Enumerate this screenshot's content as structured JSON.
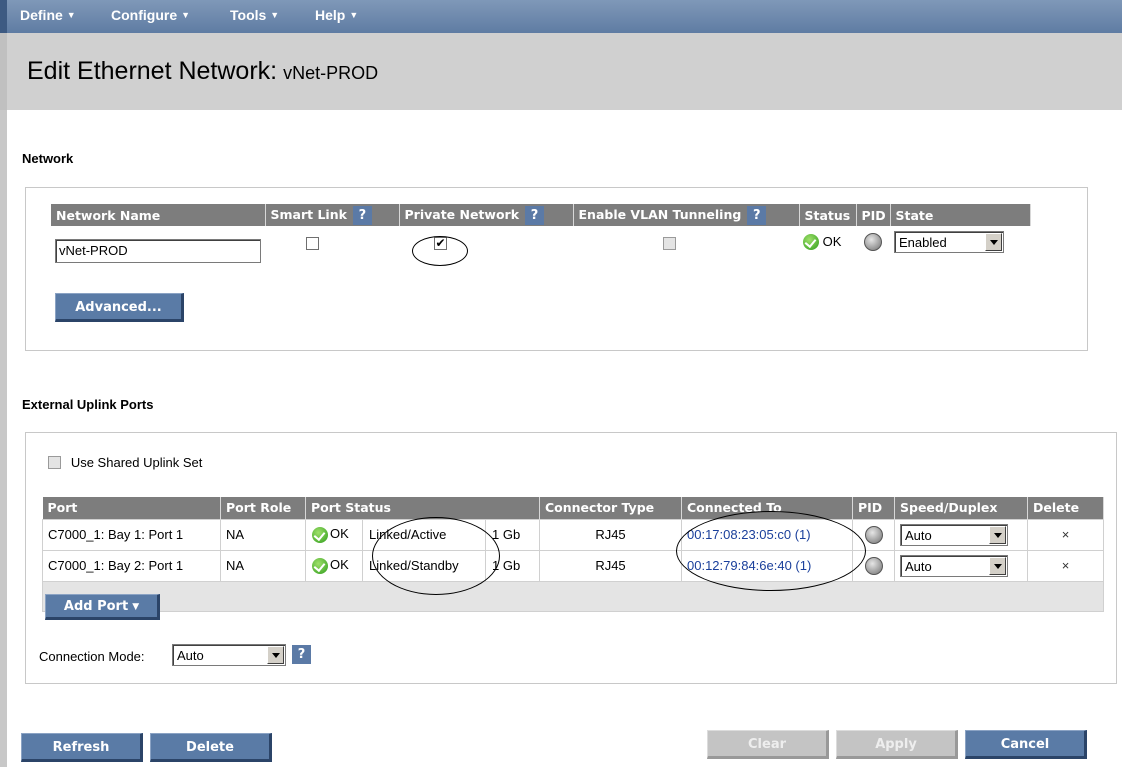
{
  "menu": [
    "Define",
    "Configure",
    "Tools",
    "Help"
  ],
  "title": {
    "main": "Edit Ethernet Network:",
    "network": "vNet-PROD"
  },
  "network_section": {
    "heading": "Network",
    "headers": {
      "name": "Network Name",
      "smart_link": "Smart Link",
      "private_network": "Private Network",
      "vlan_tunneling": "Enable VLAN Tunneling",
      "status": "Status",
      "pid": "PID",
      "state": "State"
    },
    "help_mark": "?",
    "row": {
      "name_value": "vNet-PROD",
      "smart_link_checked": false,
      "private_network_checked": true,
      "vlan_tunneling_checked": false,
      "status": "OK",
      "state": "Enabled"
    },
    "advanced_label": "Advanced..."
  },
  "uplink_section": {
    "heading": "External Uplink Ports",
    "use_shared_label": "Use Shared Uplink Set",
    "headers": {
      "port": "Port",
      "role": "Port Role",
      "status": "Port Status",
      "connector": "Connector Type",
      "connected_to": "Connected To",
      "pid": "PID",
      "speed": "Speed/Duplex",
      "delete": "Delete"
    },
    "rows": [
      {
        "port": "C7000_1: Bay 1: Port 1",
        "role": "NA",
        "status": "OK",
        "link": "Linked/Active",
        "speed_gb": "1 Gb",
        "connector": "RJ45",
        "connected_to": "00:17:08:23:05:c0 (1)",
        "duplex": "Auto",
        "delete": "×"
      },
      {
        "port": "C7000_1: Bay 2: Port 1",
        "role": "NA",
        "status": "OK",
        "link": "Linked/Standby",
        "speed_gb": "1 Gb",
        "connector": "RJ45",
        "connected_to": "00:12:79:84:6e:40 (1)",
        "duplex": "Auto",
        "delete": "×"
      }
    ],
    "add_port_label": "Add Port",
    "connection_mode_label": "Connection Mode:",
    "connection_mode_value": "Auto"
  },
  "footer": {
    "refresh": "Refresh",
    "delete": "Delete",
    "clear": "Clear",
    "apply": "Apply",
    "cancel": "Cancel"
  },
  "colors": {
    "menu": "#6a86ab",
    "button": "#5a7ba6",
    "header": "#7d7d7d",
    "title_band": "#d0d0d0",
    "link": "#1a3f9b"
  },
  "icons": [
    "chevron-down-icon",
    "help-icon",
    "ok-status-icon",
    "pid-indicator-icon",
    "delete-x-icon"
  ]
}
